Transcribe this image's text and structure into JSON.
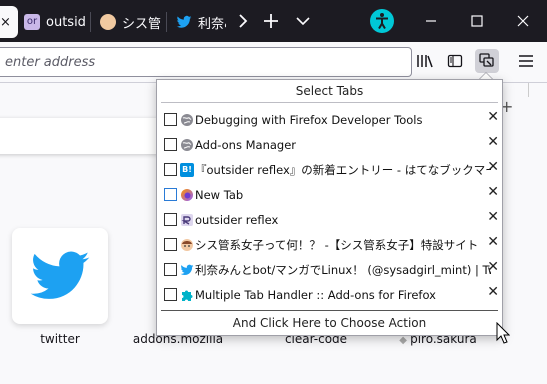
{
  "tabs": [
    {
      "label": "outside"
    },
    {
      "label": "シス管"
    },
    {
      "label": "利奈み"
    }
  ],
  "toolbar_icons": [
    "chevron-right-icon",
    "plus-icon",
    "chevron-down-icon",
    "accessibility-icon",
    "minimize-icon",
    "maximize-icon",
    "close-icon"
  ],
  "urlbar": {
    "placeholder": "enter address"
  },
  "nav_icons": [
    "library-icon",
    "sidebar-icon",
    "multiple-tab-handler-icon",
    "menu-icon"
  ],
  "popup": {
    "header": "Select Tabs",
    "footer": "And Click Here to Choose Action",
    "items": [
      {
        "title": "Debugging with Firefox Developer Tools",
        "icon": "firefox-globe-icon"
      },
      {
        "title": "Add-ons Manager",
        "icon": "firefox-globe-icon"
      },
      {
        "title": "『outsider reflex』の新着エントリー - はてなブックマーク",
        "icon": "hatena-bookmark-icon"
      },
      {
        "title": "New Tab",
        "icon": "firefox-icon"
      },
      {
        "title": "outsider reflex",
        "icon": "outsider-reflex-icon"
      },
      {
        "title": "シス管系女子って何！？ -【シス管系女子】特設サイト",
        "icon": "sysadgirl-icon"
      },
      {
        "title": "利奈みんとbot/マンガでLinux！ (@sysadgirl_mint) | Twitter",
        "icon": "twitter-icon"
      },
      {
        "title": "Multiple Tab Handler :: Add-ons for Firefox",
        "icon": "puzzle-icon"
      }
    ]
  },
  "top_sites": [
    {
      "label": "twitter"
    },
    {
      "label": "addons.mozilla"
    },
    {
      "label": "clear-code"
    },
    {
      "label": "piro.sakura"
    }
  ],
  "colors": {
    "tabbar": "#1c1b22",
    "accent": "#1da1f2",
    "accessibility": "#00c8d7"
  }
}
